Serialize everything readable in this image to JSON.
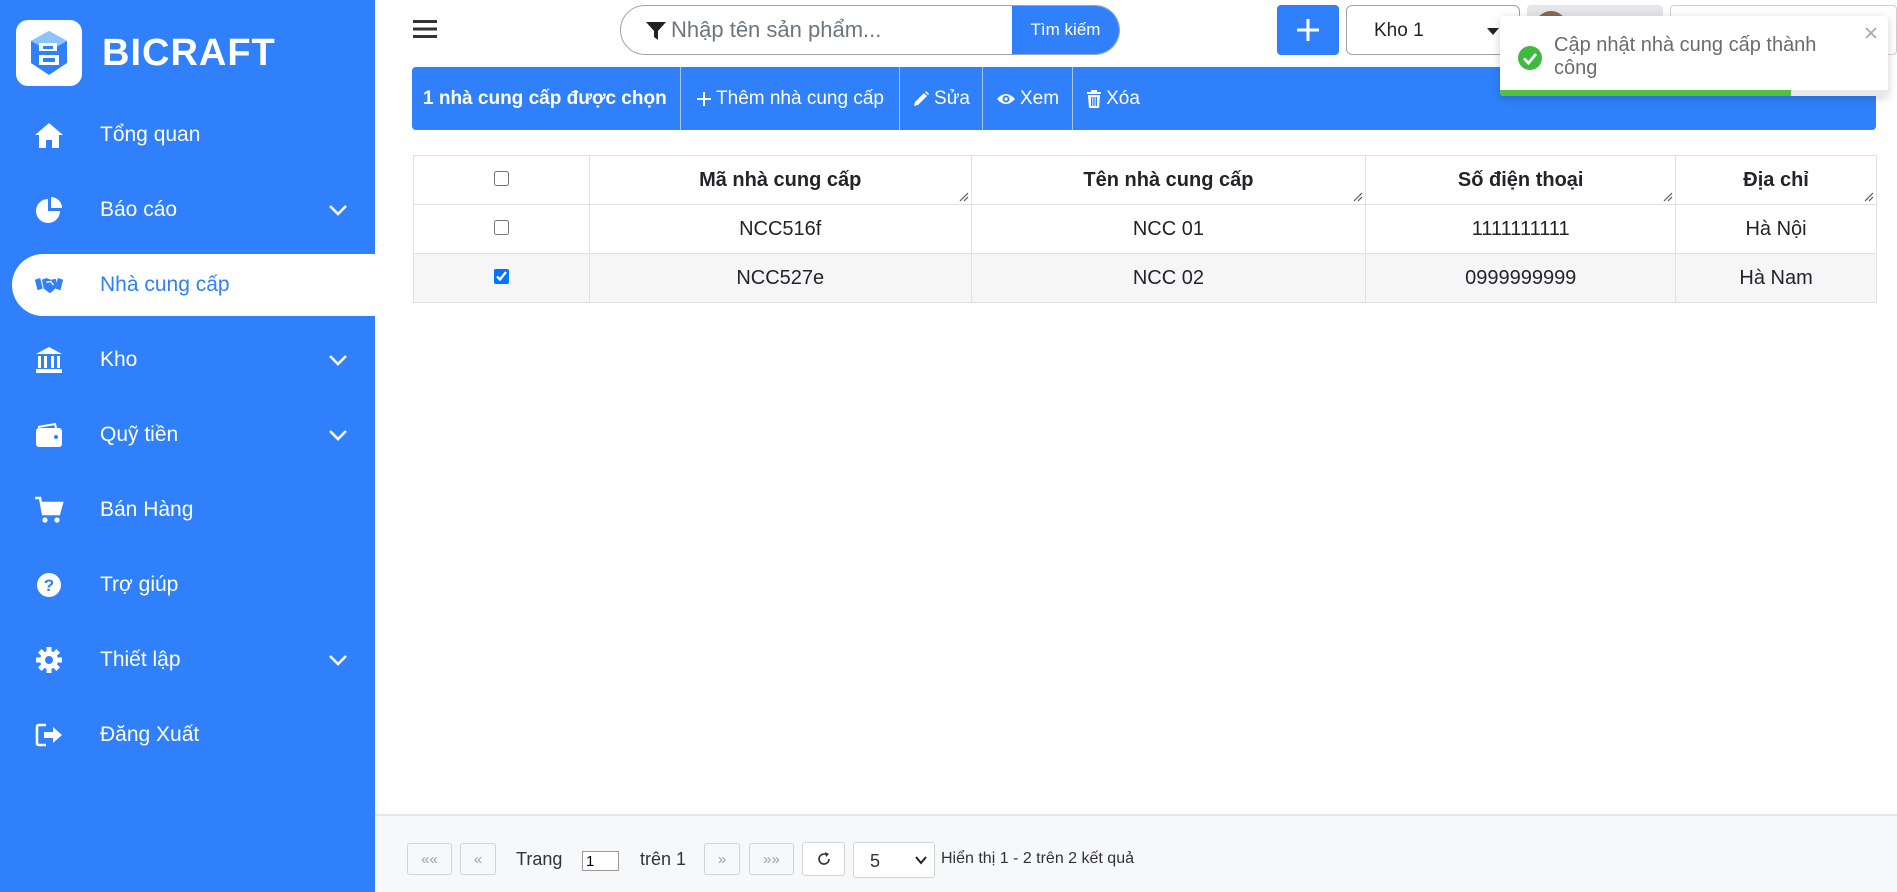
{
  "app": {
    "brand": "BICRAFT"
  },
  "sidebar": {
    "items": [
      {
        "label": "Tổng quan",
        "icon": "home-icon",
        "expandable": false,
        "active": false
      },
      {
        "label": "Báo cáo",
        "icon": "pie-chart-icon",
        "expandable": true,
        "active": false
      },
      {
        "label": "Nhà cung cấp",
        "icon": "handshake-icon",
        "expandable": false,
        "active": true
      },
      {
        "label": "Kho",
        "icon": "bank-icon",
        "expandable": true,
        "active": false
      },
      {
        "label": "Quỹ tiền",
        "icon": "wallet-icon",
        "expandable": true,
        "active": false
      },
      {
        "label": "Bán Hàng",
        "icon": "cart-icon",
        "expandable": false,
        "active": false
      },
      {
        "label": "Trợ giúp",
        "icon": "help-icon",
        "expandable": false,
        "active": false
      },
      {
        "label": "Thiết lập",
        "icon": "gear-icon",
        "expandable": true,
        "active": false
      },
      {
        "label": "Đăng Xuất",
        "icon": "logout-icon",
        "expandable": false,
        "active": false
      }
    ]
  },
  "topbar": {
    "search_placeholder": "Nhập tên sản phẩm...",
    "search_button": "Tìm kiếm",
    "add_button_icon": "plus-icon",
    "warehouse": "Kho 1"
  },
  "actions": {
    "selected_count": "1 nhà cung cấp được chọn",
    "add": "Thêm nhà cung cấp",
    "edit": "Sửa",
    "view": "Xem",
    "delete": "Xóa"
  },
  "table": {
    "columns": [
      "Mã nhà cung cấp",
      "Tên nhà cung cấp",
      "Số điện thoại",
      "Địa chỉ"
    ],
    "rows": [
      {
        "checked": false,
        "code": "NCC516f",
        "name": "NCC 01",
        "phone": "1111111111",
        "address": "Hà Nội"
      },
      {
        "checked": true,
        "code": "NCC527e",
        "name": "NCC 02",
        "phone": "0999999999",
        "address": "Hà Nam"
      }
    ]
  },
  "pagination": {
    "first": "««",
    "prev": "«",
    "page_label": "Trang",
    "page_value": "1",
    "of_label": "trên 1",
    "next": "»",
    "last": "»»",
    "per_page": "5",
    "summary": "Hiển thị 1 - 2 trên 2 kết quả"
  },
  "toast": {
    "message": "Cập nhật nhà cung cấp thành công",
    "progress": 0.75,
    "colors": {
      "success": "#53c13f"
    }
  },
  "colors": {
    "primary": "#2f80fa"
  }
}
